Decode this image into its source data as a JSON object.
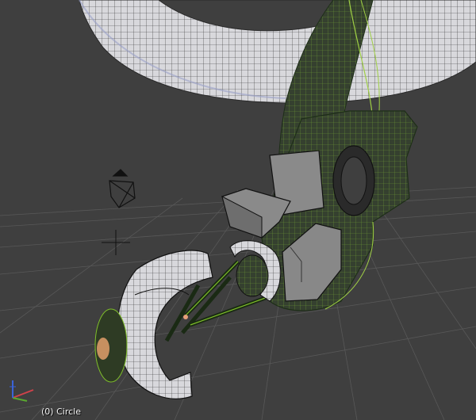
{
  "viewport": {
    "object_label": "(0) Circle",
    "background_color": "#3f3f3f",
    "grid_color": "#5a5a5a",
    "wire_color_selected": "#7fbf2a",
    "wire_color_dark": "#1e2e18",
    "mesh_fill_color": "#c9cad6",
    "origin_color": "#e7a07a"
  },
  "axes_gizmo": {
    "x_color": "#d0424a",
    "y_color": "#5aa830",
    "z_color": "#3a63d8"
  }
}
